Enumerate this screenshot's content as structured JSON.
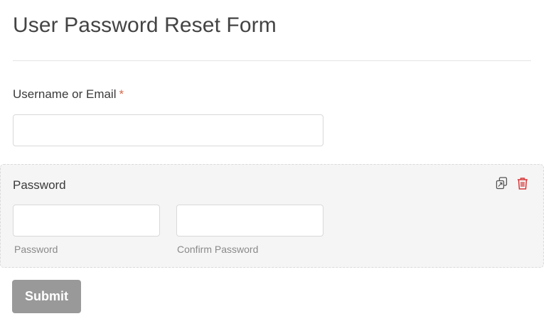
{
  "form": {
    "title": "User Password Reset Form"
  },
  "username_field": {
    "label": "Username or Email",
    "required_marker": "*",
    "value": "",
    "placeholder": ""
  },
  "password_field": {
    "label": "Password",
    "password_sublabel": "Password",
    "confirm_sublabel": "Confirm Password",
    "password_value": "",
    "confirm_value": "",
    "actions": {
      "duplicate_icon": "duplicate-icon",
      "delete_icon": "trash-icon"
    }
  },
  "submit": {
    "label": "Submit"
  },
  "colors": {
    "required": "#d46a4a",
    "delete": "#d63638",
    "submit_bg": "#999999",
    "block_bg": "#f5f5f5"
  }
}
